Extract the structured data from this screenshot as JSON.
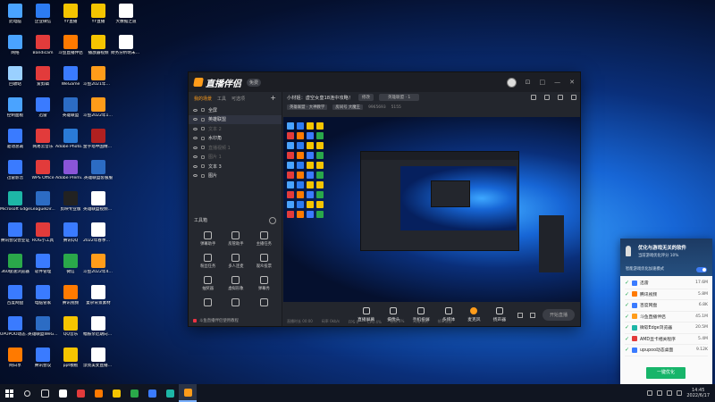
{
  "desktop": {
    "icons": [
      {
        "label": "此电脑",
        "color": "#4aa3ff",
        "col": 0,
        "row": 0
      },
      {
        "label": "企业微信",
        "color": "#2c7bf2",
        "col": 1,
        "row": 0
      },
      {
        "label": "YY直播",
        "color": "#f5c400",
        "col": 2,
        "row": 0
      },
      {
        "label": "YY直播",
        "color": "#f5c400",
        "col": 3,
        "row": 0
      },
      {
        "label": "大数据之道",
        "color": "#ffffff",
        "col": 4,
        "row": 0
      },
      {
        "label": "网络",
        "color": "#4aa3ff",
        "col": 0,
        "row": 1
      },
      {
        "label": "Bandicam",
        "color": "#e23b3b",
        "col": 1,
        "row": 1
      },
      {
        "label": "斗鱼直播伴侣",
        "color": "#ff7a00",
        "col": 2,
        "row": 1
      },
      {
        "label": "播放器视频",
        "color": "#f5c400",
        "col": 3,
        "row": 1
      },
      {
        "label": "财务分析明末论文",
        "color": "#ffffff",
        "col": 4,
        "row": 1
      },
      {
        "label": "回收站",
        "color": "#9ad0ff",
        "col": 0,
        "row": 2
      },
      {
        "label": "爱剪辑",
        "color": "#e23b3b",
        "col": 1,
        "row": 2
      },
      {
        "label": "WeGame",
        "color": "#3a7bff",
        "col": 2,
        "row": 2
      },
      {
        "label": "斗鱼2021年下半年直播...",
        "color": "#ff9c1a",
        "col": 3,
        "row": 2
      },
      {
        "label": "控制面板",
        "color": "#4aa3ff",
        "col": 0,
        "row": 3
      },
      {
        "label": "迅雷",
        "color": "#3a7bff",
        "col": 1,
        "row": 3
      },
      {
        "label": "英雄联盟",
        "color": "#2c6cc4",
        "col": 2,
        "row": 3
      },
      {
        "label": "斗鱼2022年1-3月直播...",
        "color": "#ff9c1a",
        "col": 3,
        "row": 3
      },
      {
        "label": "驱动总裁",
        "color": "#3a7bff",
        "col": 0,
        "row": 4
      },
      {
        "label": "网易云音乐",
        "color": "#e23b3b",
        "col": 1,
        "row": 4
      },
      {
        "label": "Adobe Photosh...",
        "color": "#2a7ad6",
        "col": 2,
        "row": 4
      },
      {
        "label": "金字塔中国精校本(x64)",
        "color": "#b02020",
        "col": 3,
        "row": 4
      },
      {
        "label": "迅雷影音",
        "color": "#3a7bff",
        "col": 0,
        "row": 5
      },
      {
        "label": "WPS Office",
        "color": "#e23b3b",
        "col": 1,
        "row": 5
      },
      {
        "label": "Adobe Premie...",
        "color": "#8a55d8",
        "col": 2,
        "row": 5
      },
      {
        "label": "英雄联盟客服服",
        "color": "#2c6cc4",
        "col": 3,
        "row": 5
      },
      {
        "label": "Microsoft Edge",
        "color": "#1db6a6",
        "col": 0,
        "row": 6
      },
      {
        "label": "LeagueDir...",
        "color": "#2c6cc4",
        "col": 1,
        "row": 6
      },
      {
        "label": "剪映专业版",
        "color": "#222222",
        "col": 2,
        "row": 6
      },
      {
        "label": "英雄联盟视频bgm",
        "color": "#ffffff",
        "col": 3,
        "row": 6
      },
      {
        "label": "腾讯会议营业证",
        "color": "#3a7bff",
        "col": 0,
        "row": 7
      },
      {
        "label": "ROG小工具",
        "color": "#e23b3b",
        "col": 1,
        "row": 7
      },
      {
        "label": "腾讯QQ",
        "color": "#3a7bff",
        "col": 2,
        "row": 7
      },
      {
        "label": "2022年春季营销新文案",
        "color": "#ffffff",
        "col": 3,
        "row": 7
      },
      {
        "label": "360极速浏览器",
        "color": "#2aa84a",
        "col": 0,
        "row": 8
      },
      {
        "label": "软件管理",
        "color": "#3a7bff",
        "col": 1,
        "row": 8
      },
      {
        "label": "微信",
        "color": "#2aa84a",
        "col": 2,
        "row": 8
      },
      {
        "label": "斗鱼2022年4-6月直播...",
        "color": "#ff9c1a",
        "col": 3,
        "row": 8
      },
      {
        "label": "百度网盘",
        "color": "#3a7bff",
        "col": 0,
        "row": 9
      },
      {
        "label": "电脑管家",
        "color": "#3a7bff",
        "col": 1,
        "row": 9
      },
      {
        "label": "腾讯视频",
        "color": "#ff7a00",
        "col": 2,
        "row": 9
      },
      {
        "label": "复杂背景素材",
        "color": "#ffffff",
        "col": 3,
        "row": 9
      },
      {
        "label": "UPUPOO动态桌面",
        "color": "#3a7bff",
        "col": 0,
        "row": 10
      },
      {
        "label": "英雄联盟WeGame版",
        "color": "#2c6cc4",
        "col": 1,
        "row": 10
      },
      {
        "label": "QQ音乐",
        "color": "#f5c400",
        "col": 2,
        "row": 10
      },
      {
        "label": "幅振亲近期向性直播...",
        "color": "#ffffff",
        "col": 3,
        "row": 10
      },
      {
        "label": "网日享",
        "color": "#ff7a00",
        "col": 0,
        "row": 11
      },
      {
        "label": "腾讯会议",
        "color": "#3a7bff",
        "col": 1,
        "row": 11
      },
      {
        "label": "ppt模板",
        "color": "#f5c400",
        "col": 2,
        "row": 11
      },
      {
        "label": "漂亮美女直播画面素材",
        "color": "#ffffff",
        "col": 3,
        "row": 11
      }
    ]
  },
  "app": {
    "name": "直播伴侣",
    "version_badge": "免费",
    "window_controls": [
      "⊡",
      "□",
      "—",
      "✕"
    ],
    "left_tabs": [
      "我的场景",
      "工具",
      "可选项"
    ],
    "scenes": [
      {
        "label": "全屏",
        "dim": false,
        "selected": false
      },
      {
        "label": "英雄联盟",
        "dim": false,
        "selected": true
      },
      {
        "label": "文本 2",
        "dim": true,
        "selected": false
      },
      {
        "label": "水印角",
        "dim": false,
        "selected": false
      },
      {
        "label": "直播视频 1",
        "dim": true,
        "selected": false
      },
      {
        "label": "图片 1",
        "dim": true,
        "selected": false
      },
      {
        "label": "文本 3",
        "dim": false,
        "selected": false
      },
      {
        "label": "图片",
        "dim": false,
        "selected": false
      }
    ],
    "tools_title": "工具箱",
    "tools": [
      "弹幕助手",
      "房管助手",
      "主播任务",
      "粉丝任务",
      "多人连麦",
      "观众投票",
      "抽奖器",
      "虚拟形象",
      "弹幕秀",
      "",
      "",
      ""
    ],
    "notice": "斗鱼直播伴侣使用教程",
    "room_title": "小材姐：虚空女皇18连中攻略！",
    "room_edit": "修改",
    "room_category": "英雄联盟 · 1",
    "meta": [
      "英雄联盟 · 大神教学",
      "房间号 大魔王",
      "9965693",
      "5155"
    ],
    "bottom_buttons": [
      "直播屏幕",
      "摄像头",
      "手机投屏",
      "多媒体",
      "麦克风",
      "扬声器"
    ],
    "start_button": "开始直播",
    "status_items": [
      "直播时长 00:00",
      "码率 0kb/s",
      "FPS 0",
      "CPU 4%",
      "丢帧 0%",
      "网络 良好",
      "帧率设置"
    ]
  },
  "popup": {
    "title": "优化与游戏无关的软件",
    "subtitle": "当前游戏优化评分 10%",
    "mode_label": "智能游戏优化加速模式",
    "items": [
      {
        "name": "迅雷",
        "size": "17.6M",
        "color": "#3a7bff"
      },
      {
        "name": "腾讯视频",
        "size": "5.8M",
        "color": "#ff7a00"
      },
      {
        "name": "百度网盘",
        "size": "6.8K",
        "color": "#3a7bff"
      },
      {
        "name": "斗鱼直播伴侣",
        "size": "45.1M",
        "color": "#ff9c1a"
      },
      {
        "name": "微软Edge浏览器",
        "size": "20.5M",
        "color": "#1db6a6"
      },
      {
        "name": "AMD显卡相关程序",
        "size": "5.4M",
        "color": "#e23b3b"
      },
      {
        "name": "upupoo动态桌面",
        "size": "9.12K",
        "color": "#3a7bff"
      }
    ],
    "button": "一键优化"
  },
  "taskbar": {
    "apps": [
      "#ffffff",
      "#e23b3b",
      "#ff7a00",
      "#f5c400",
      "#2aa84a",
      "#3a7bff",
      "#1db6a6",
      "#ff9c1a"
    ],
    "time": "14:45",
    "date": "2022/6/17"
  }
}
